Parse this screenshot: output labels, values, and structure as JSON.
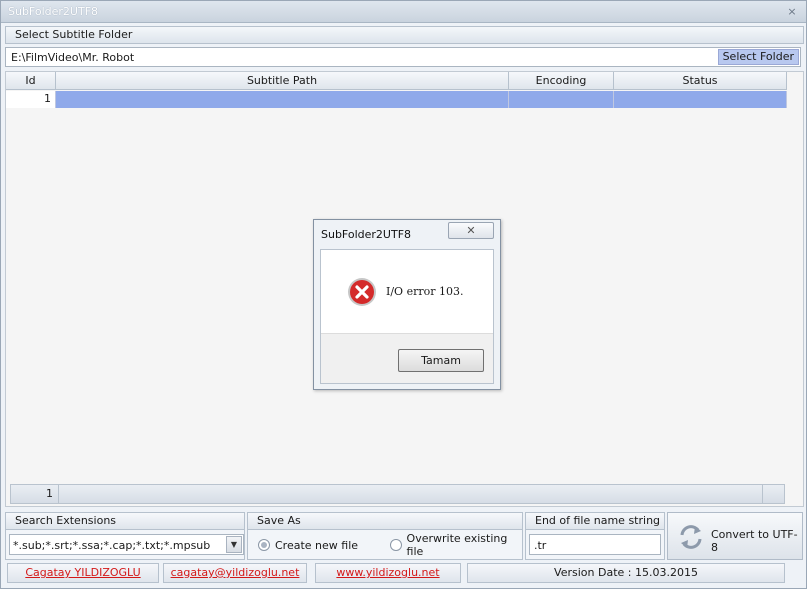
{
  "window": {
    "title": "SubFolder2UTF8",
    "close_glyph": "×"
  },
  "folder": {
    "header": "Select Subtitle Folder",
    "path": "E:\\FilmVideo\\Mr. Robot",
    "select_button": "Select Folder"
  },
  "grid": {
    "columns": [
      "Id",
      "Subtitle Path",
      "Encoding",
      "Status"
    ],
    "rows": [
      {
        "id": "1",
        "path": "",
        "encoding": "",
        "status": ""
      }
    ],
    "footer_count": "1"
  },
  "search": {
    "header": "Search Extensions",
    "value": "*.sub;*.srt;*.ssa;*.cap;*.txt;*.mpsub"
  },
  "save_as": {
    "header": "Save As",
    "options": [
      {
        "label": "Create new file",
        "selected": true
      },
      {
        "label": "Overwrite existing file",
        "selected": false
      }
    ]
  },
  "suffix": {
    "header": "End of file name string",
    "value": ".tr"
  },
  "convert": {
    "label": "Convert to UTF-8",
    "icon": "refresh-icon"
  },
  "status": {
    "author": "Cagatay YILDIZOGLU",
    "email": "cagatay@yildizoglu.net",
    "website": "www.yildizoglu.net",
    "version": "Version Date : 15.03.2015"
  },
  "dialog": {
    "title": "SubFolder2UTF8",
    "message": "I/O error 103.",
    "ok_label": "Tamam",
    "icon": "error-icon",
    "close_glyph": "✕"
  },
  "colors": {
    "selection": "#8fa9ea",
    "link": "#d41818",
    "error": "#d42a2a"
  }
}
